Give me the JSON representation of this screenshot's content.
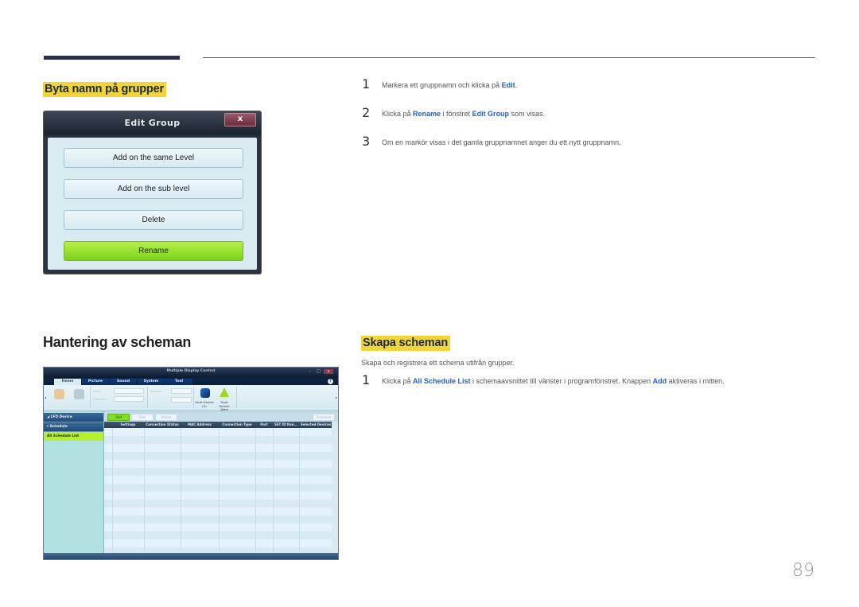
{
  "section1": {
    "heading": "Byta namn på grupper",
    "steps": [
      {
        "num": "1",
        "parts": [
          {
            "t": "Markera ett gruppnamn och klicka på "
          },
          {
            "t": "Edit",
            "hl": true
          },
          {
            "t": "."
          }
        ]
      },
      {
        "num": "2",
        "parts": [
          {
            "t": "Klicka på "
          },
          {
            "t": "Rename",
            "hl": true
          },
          {
            "t": " i fönstret "
          },
          {
            "t": "Edit Group",
            "hl": true
          },
          {
            "t": " som visas."
          }
        ]
      },
      {
        "num": "3",
        "parts": [
          {
            "t": "Om en markör visas i det gamla gruppnamnet anger du ett nytt gruppnamn."
          }
        ]
      }
    ]
  },
  "dialog": {
    "title": "Edit Group",
    "close_label": "x",
    "buttons": [
      "Add on the same Level",
      "Add on the sub level",
      "Delete",
      "Rename"
    ]
  },
  "section2": {
    "heading": "Hantering av scheman"
  },
  "section3": {
    "heading": "Skapa scheman",
    "intro": "Skapa och registrera ett schema utifrån grupper.",
    "steps": [
      {
        "num": "1",
        "parts": [
          {
            "t": "Klicka på "
          },
          {
            "t": "All Schedule List",
            "hl": true
          },
          {
            "t": " i schemaavsnittet till vänster i programfönstret. Knappen "
          },
          {
            "t": "Add",
            "hl": true
          },
          {
            "t": " aktiveras i mitten."
          }
        ]
      }
    ]
  },
  "app": {
    "title": "Multiple Display Control",
    "window_buttons": [
      "–",
      "□",
      "x"
    ],
    "tabs": [
      "Home",
      "Picture",
      "Sound",
      "System",
      "Tool"
    ],
    "active_tab": "Home",
    "ribbon": {
      "fields": [
        "Input",
        "Channel",
        "Volume"
      ],
      "fault_device": "Fault Device (0)",
      "fault_alert": "Fault Device Alert"
    },
    "sidebar": [
      "LFD Device",
      "Schedule",
      "All Schedule List"
    ],
    "toolbar_buttons": [
      "Add",
      "Edit",
      "Delete"
    ],
    "toolbar_right": "Schedule",
    "columns": [
      "Settings",
      "Connection Status",
      "MAC Address",
      "Connection Type",
      "Port",
      "SET ID Ran...",
      "Selected Devices"
    ],
    "row_count": 16
  },
  "page_number": "89"
}
